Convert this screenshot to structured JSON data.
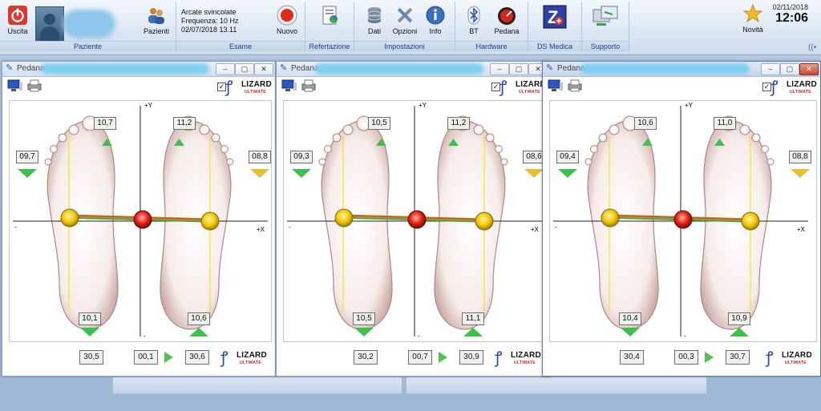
{
  "ribbon": {
    "uscita": "Uscita",
    "pazienti": "Pazienti",
    "group_paziente": "Paziente",
    "exam_status": "Arcate svincolate",
    "exam_frequency": "Frequenza: 10 Hz",
    "exam_datetime": "02/07/2018 13.11",
    "nuovo": "Nuovo",
    "group_esame": "Esame",
    "group_refertazione": "Refertazione",
    "dati": "Dati",
    "opzioni": "Opzioni",
    "info": "Info",
    "group_impostazioni": "Impostazioni",
    "bt": "BT",
    "pedana": "Pedana",
    "group_hardware": "Hardware",
    "group_dsmedica": "DS Medica",
    "group_supporto": "Supporto",
    "novita": "Novità",
    "date": "02/11/2018",
    "time": "12:06"
  },
  "colors": {
    "accent": "#15428b",
    "up_arrow": "#3cc24a",
    "down_arrow_left": "#3cc24a",
    "down_arrow_right": "#e6c030",
    "line": "#b7a42e"
  },
  "windows": [
    {
      "title": "Pedana",
      "logo_word": "LIZARD",
      "logo_sub": "ULTIMATE",
      "axis_y": "+Y",
      "axis_x": "+X",
      "axis_minus": "-",
      "left_toe": "10,7",
      "right_toe": "11,2",
      "left_side": "09,7",
      "right_side": "08,8",
      "left_heel": "10,1",
      "right_heel": "10,6",
      "left_total": "30,5",
      "center": "00,1",
      "right_total": "30,6"
    },
    {
      "title": "Pedana",
      "logo_word": "LIZARD",
      "logo_sub": "ULTIMATE",
      "axis_y": "+Y",
      "axis_x": "+X",
      "axis_minus": "-",
      "left_toe": "10,5",
      "right_toe": "11,2",
      "left_side": "09,3",
      "right_side": "08,6",
      "left_heel": "10,5",
      "right_heel": "11,1",
      "left_total": "30,2",
      "center": "00,7",
      "right_total": "30,9"
    },
    {
      "title": "Pedana",
      "logo_word": "LIZARD",
      "logo_sub": "ULTIMATE",
      "axis_y": "+Y",
      "axis_x": "+X",
      "axis_minus": "-",
      "left_toe": "10,6",
      "right_toe": "11,0",
      "left_side": "09,4",
      "right_side": "08,8",
      "left_heel": "10,4",
      "right_heel": "10,9",
      "left_total": "30,4",
      "center": "00,3",
      "right_total": "30,7"
    }
  ]
}
